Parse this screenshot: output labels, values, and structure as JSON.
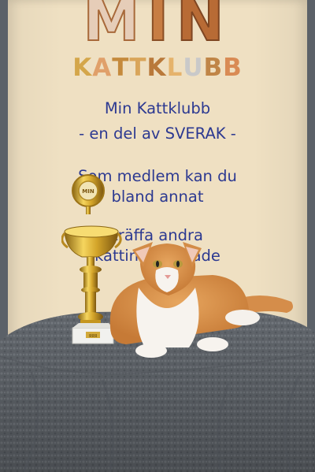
{
  "logo": {
    "title_letters": [
      "M",
      "I",
      "N"
    ],
    "subtitle_letters": [
      "K",
      "A",
      "T",
      "T",
      "K",
      "L",
      "U",
      "B",
      "B"
    ],
    "title_colors": [
      "#e6cdb8",
      "#c77d43",
      "#b86b35"
    ],
    "subtitle_colors": [
      "#d4a64a",
      "#e0a06a",
      "#c58a3c",
      "#d9a55a",
      "#b9793a",
      "#e5b36c",
      "#cfd0cf",
      "#c08547",
      "#d98b54"
    ]
  },
  "banner_text": {
    "heading": "Min Kattklubb",
    "subheading": "- en del av SVERAK -",
    "line1": "Som medlem kan du",
    "line2": "bland annat",
    "line3": "träffa andra",
    "line4": "kattintresserade"
  },
  "trophy": {
    "plaque": "ЯЯЯ",
    "medal_text": "MIN"
  },
  "colors": {
    "banner": "#efe0c2",
    "text": "#2c3991",
    "cloth": "#62676d",
    "gold": "#d4a52a",
    "cat_orange": "#d88f4a"
  }
}
